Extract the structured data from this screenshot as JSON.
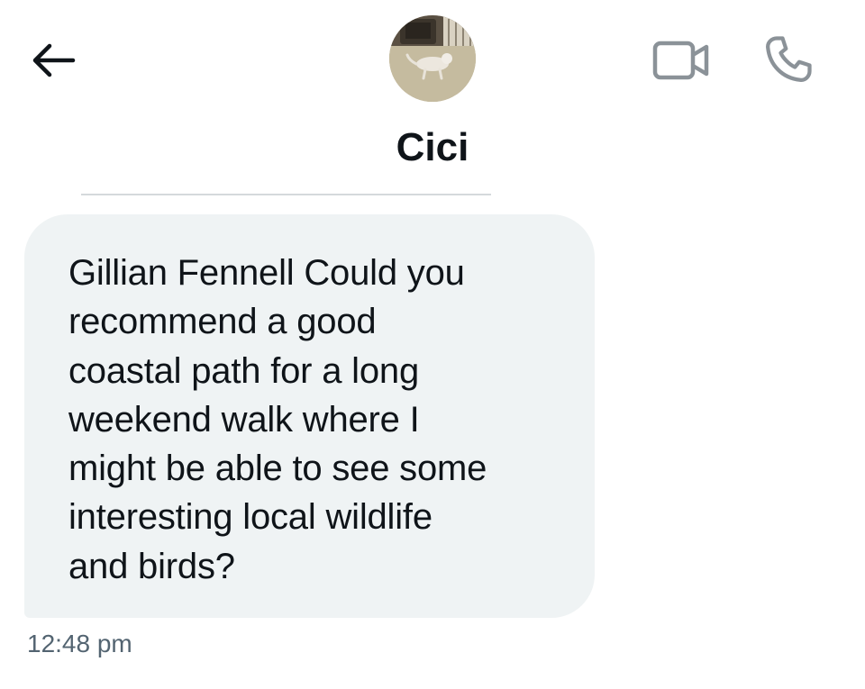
{
  "header": {
    "back_icon": "arrow-left-icon",
    "avatar_icon": "cat-profile-photo",
    "video_icon": "video-camera-icon",
    "phone_icon": "phone-icon",
    "icon_color": "#0f1419",
    "secondary_icon_color": "#8b9298"
  },
  "contact": {
    "name": "Cici"
  },
  "conversation": {
    "messages": [
      {
        "lines": [
          "Gillian Fennell Could you",
          "recommend a good",
          "coastal path for a long",
          "weekend walk where I",
          "might be able to see some",
          "interesting local wildlife",
          "and birds?"
        ],
        "timestamp": "12:48 pm",
        "bubble_color": "#eff3f4"
      }
    ]
  }
}
